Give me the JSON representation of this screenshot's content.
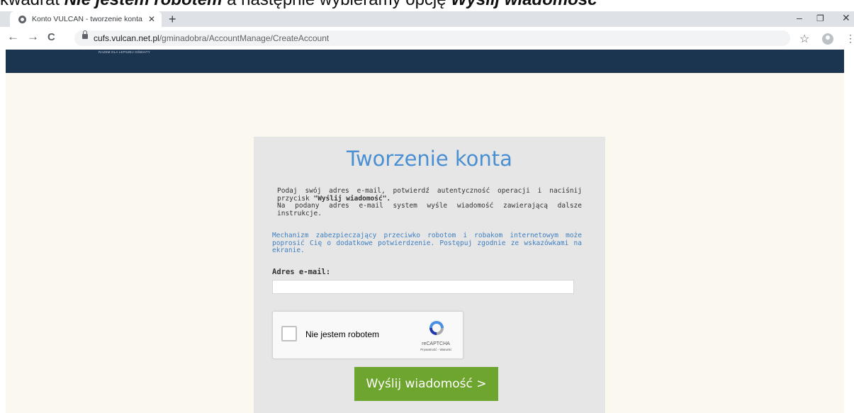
{
  "caption": {
    "text_before": "kwadrat ",
    "bold1": "Nie jestem robotem",
    "text_middle": " a następnie wybieramy opcję ",
    "bold2": "Wyślij wiadomość"
  },
  "browser": {
    "tab_title": "Konto VULCAN - tworzenie konta",
    "tab_close": "✕",
    "new_tab": "+",
    "url_host": "cufs.vulcan.net.pl",
    "url_path": "/gminadobra/AccountManage/CreateAccount",
    "back": "←",
    "forward": "→",
    "reload": "C",
    "star": "☆",
    "menu": "⋮",
    "minimize": "–",
    "restore": "❐",
    "close": "✕"
  },
  "banner": {
    "slogan": "RAZEM DLA LEPSZEJ OŚWIATY"
  },
  "form": {
    "title": "Tworzenie konta",
    "instr_line1": "Podaj swój adres e-mail, potwierdź autentyczność operacji i naciśnij przycisk ",
    "instr_bold": "\"Wyślij wiadomość\".",
    "instr_line2": "Na podany adres e-mail system wyśle wiadomość zawierającą dalsze instrukcje.",
    "warning": "Mechanizm zabezpieczający przeciwko robotom i robakom internetowym może poprosić Cię o dodatkowe potwierdzenie. Postępuj zgodnie ze wskazówkami na ekranie.",
    "email_label": "Adres e-mail:",
    "email_value": "",
    "captcha_label": "Nie jestem robotem",
    "captcha_brand": "reCAPTCHA",
    "captcha_links": "Prywatność - Warunki",
    "send_button": "Wyślij wiadomość >"
  },
  "colors": {
    "banner": "#1b3551",
    "title": "#4a8fd1",
    "button": "#6ea52e",
    "warning_text": "#3f7fbf"
  },
  "icons": [
    "globe-icon",
    "lock-icon",
    "star-icon",
    "profile-icon",
    "menu-icon",
    "recaptcha-logo-icon"
  ]
}
